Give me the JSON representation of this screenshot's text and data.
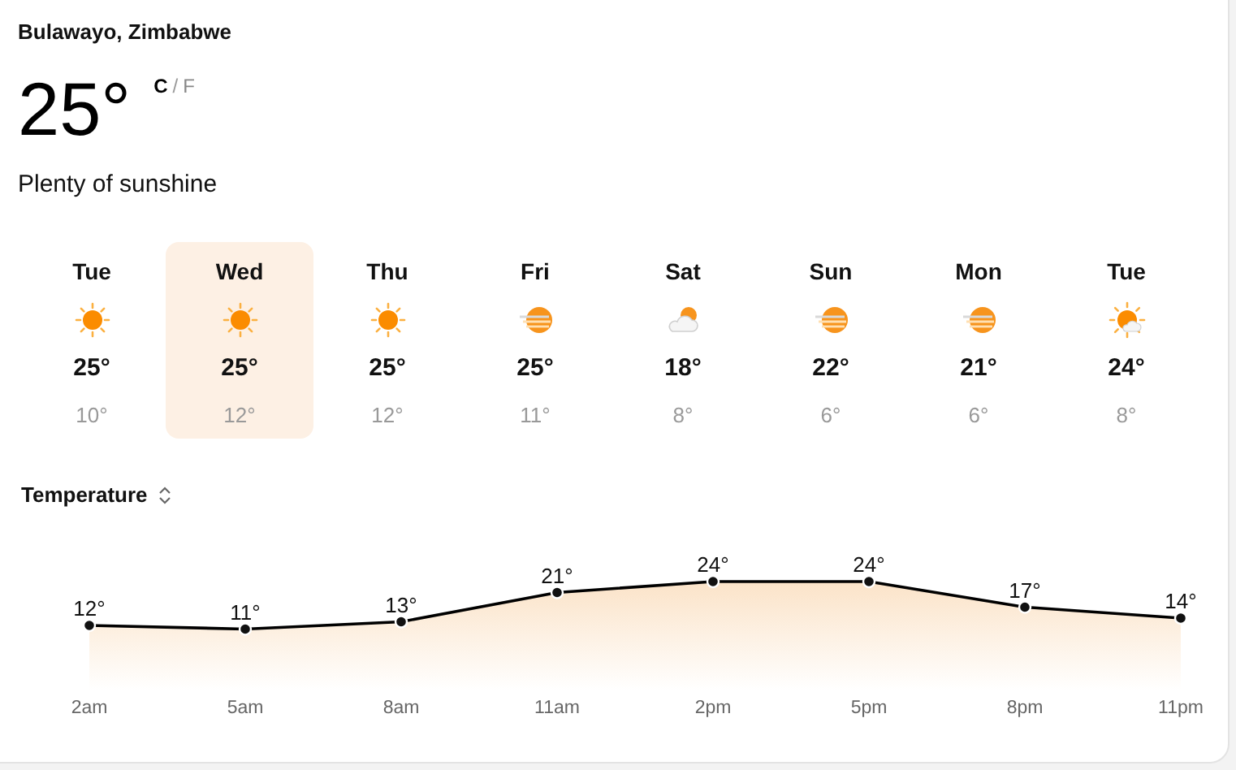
{
  "location": "Bulawayo, Zimbabwe",
  "current": {
    "temperature": "25°",
    "units": [
      {
        "label": "C",
        "selected": true
      },
      {
        "label": "F",
        "selected": false
      }
    ],
    "unit_separator": "/",
    "condition": "Plenty of sunshine"
  },
  "days": [
    {
      "day": "Tue",
      "kind": "sunny",
      "high": "25°",
      "low": "10°",
      "selected": false
    },
    {
      "day": "Wed",
      "kind": "sunny",
      "high": "25°",
      "low": "12°",
      "selected": true
    },
    {
      "day": "Thu",
      "kind": "sunny",
      "high": "25°",
      "low": "12°",
      "selected": false
    },
    {
      "day": "Fri",
      "kind": "hazy",
      "high": "25°",
      "low": "11°",
      "selected": false
    },
    {
      "day": "Sat",
      "kind": "partly-cloudy",
      "high": "18°",
      "low": "8°",
      "selected": false
    },
    {
      "day": "Sun",
      "kind": "hazy",
      "high": "22°",
      "low": "6°",
      "selected": false
    },
    {
      "day": "Mon",
      "kind": "hazy",
      "high": "21°",
      "low": "6°",
      "selected": false
    },
    {
      "day": "Tue",
      "kind": "mostly-sunny",
      "high": "24°",
      "low": "8°",
      "selected": false
    }
  ],
  "hourly": {
    "chart_data": {
      "type": "area",
      "categories": [
        "2am",
        "5am",
        "8am",
        "11am",
        "2pm",
        "5pm",
        "8pm",
        "11pm"
      ],
      "series": [
        {
          "name": "Temperature",
          "color": "#000000",
          "values": [
            12,
            11,
            13,
            21,
            24,
            24,
            17,
            14
          ],
          "value_labels": [
            "12°",
            "11°",
            "13°",
            "21°",
            "24°",
            "24°",
            "17°",
            "14°"
          ]
        }
      ],
      "data_labels": "value_labels"
    }
  }
}
